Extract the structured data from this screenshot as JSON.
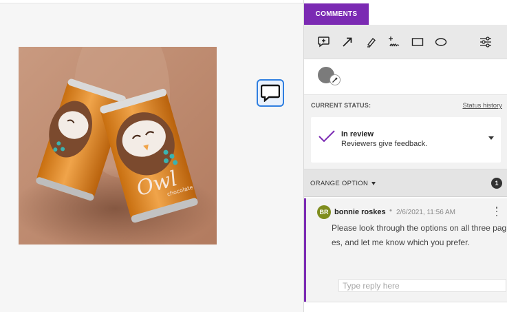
{
  "panel": {
    "tab_comments": "COMMENTS",
    "tools": [
      "comment-add-icon",
      "arrow-icon",
      "highlighter-icon",
      "freehand-icon",
      "rectangle-icon",
      "ellipse-icon",
      "settings-sliders-icon"
    ],
    "accent_color": "#7b2ab3",
    "current_color": "#7b7b7b"
  },
  "status": {
    "label": "CURRENT STATUS:",
    "history_link": "Status history",
    "title": "In review",
    "subtitle": "Reviewers give feedback."
  },
  "group": {
    "label": "ORANGE OPTION",
    "count": "1"
  },
  "comment": {
    "avatar_initials": "BR",
    "avatar_color": "#7f8d1e",
    "author": "bonnie roskes",
    "separator": "•",
    "timestamp": "2/6/2021, 11:56 AM",
    "body": "Please look through the options on all three pages, and let me know which you prefer.",
    "reply_placeholder": "Type reply here"
  },
  "canvas": {
    "artwork_text": "Owl",
    "artwork_subtext": "chocolate",
    "pin_icon": "speech-bubble-icon"
  }
}
